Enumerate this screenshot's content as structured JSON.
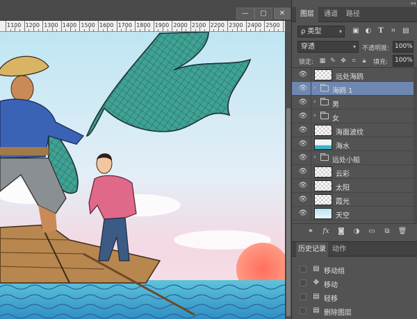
{
  "canvas": {
    "ruler_labels": [
      "1100",
      "1200",
      "1300",
      "1400",
      "1500",
      "1600",
      "1700",
      "1800",
      "1900",
      "2000",
      "2100",
      "2200",
      "2300",
      "2400",
      "2500",
      "2600"
    ]
  },
  "window_controls": {
    "minimize": "—",
    "maximize": "▢",
    "close": "✕"
  },
  "layers_panel": {
    "collapse_glyph": "◂◂",
    "tabs": [
      "图层",
      "通道",
      "路径"
    ],
    "active_tab": "图层",
    "filter_kind": "类型",
    "filter_kind_prefix": "ρ",
    "blend_mode": "穿透",
    "opacity_label": "不透明度:",
    "opacity_value": "100%",
    "lock_label": "锁定:",
    "fill_label": "填充:",
    "fill_value": "100%",
    "layers": [
      {
        "name": "远处海鸥",
        "kind": "pixel",
        "visible": true,
        "selected": false
      },
      {
        "name": "海鸥 1",
        "kind": "group",
        "visible": true,
        "selected": true
      },
      {
        "name": "男",
        "kind": "group",
        "visible": true,
        "selected": false
      },
      {
        "name": "女",
        "kind": "group",
        "visible": true,
        "selected": false
      },
      {
        "name": "海面波纹",
        "kind": "pixel",
        "visible": true,
        "selected": false
      },
      {
        "name": "海水",
        "kind": "pixel",
        "visible": true,
        "selected": false
      },
      {
        "name": "远处小船",
        "kind": "group",
        "visible": true,
        "selected": false
      },
      {
        "name": "云彩",
        "kind": "pixel",
        "visible": true,
        "selected": false
      },
      {
        "name": "太阳",
        "kind": "pixel",
        "visible": true,
        "selected": false
      },
      {
        "name": "霞光",
        "kind": "pixel",
        "visible": true,
        "selected": false
      },
      {
        "name": "天空",
        "kind": "pixel",
        "visible": true,
        "selected": false
      }
    ]
  },
  "history_panel": {
    "tabs": [
      "历史记录",
      "动作"
    ],
    "active_tab": "历史记录",
    "items": [
      {
        "label": "移动组",
        "icon": "move-group-icon"
      },
      {
        "label": "移动",
        "icon": "move-icon"
      },
      {
        "label": "轻移",
        "icon": "nudge-icon"
      },
      {
        "label": "删除图层",
        "icon": "delete-layer-icon"
      }
    ]
  }
}
